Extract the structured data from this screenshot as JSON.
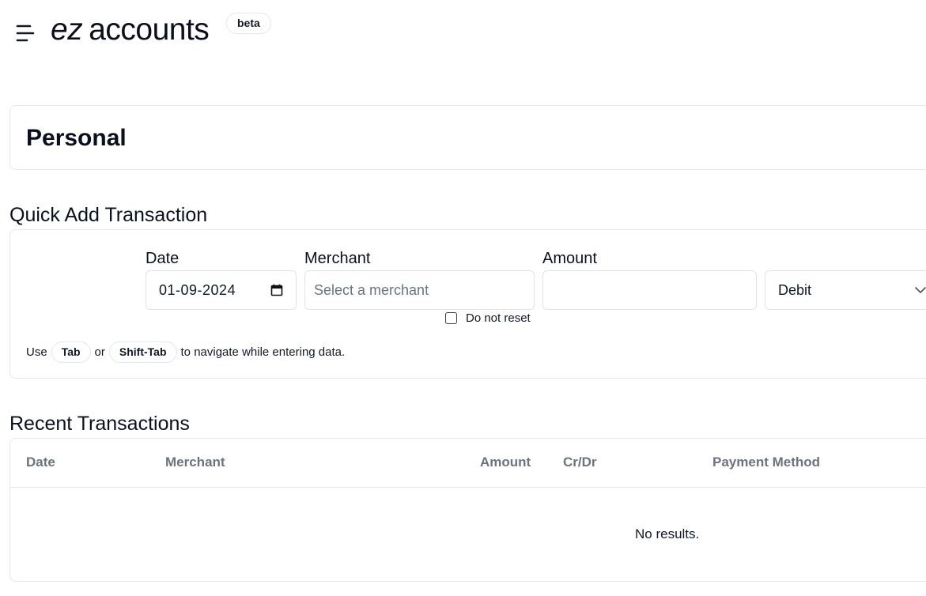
{
  "header": {
    "brand_prefix": "ez",
    "brand_name": "accounts",
    "badge": "beta",
    "menu_icon": "menu-icon"
  },
  "account": {
    "title": "Personal"
  },
  "quick_add": {
    "title": "Quick Add Transaction",
    "date_label": "Date",
    "date_value": "01-09-2024",
    "merchant_label": "Merchant",
    "merchant_placeholder": "Select a merchant",
    "amount_label": "Amount",
    "amount_value": "",
    "crdr_value": "Debit",
    "do_not_reset_label": "Do not reset",
    "do_not_reset_checked": false,
    "hint_prefix": "Use",
    "hint_key1": "Tab",
    "hint_or": "or",
    "hint_key2": "Shift-Tab",
    "hint_suffix": "to navigate while entering data."
  },
  "recent": {
    "title": "Recent Transactions",
    "columns": [
      "Date",
      "Merchant",
      "Amount",
      "Cr/Dr",
      "Payment Method"
    ],
    "empty_text": "No results."
  }
}
